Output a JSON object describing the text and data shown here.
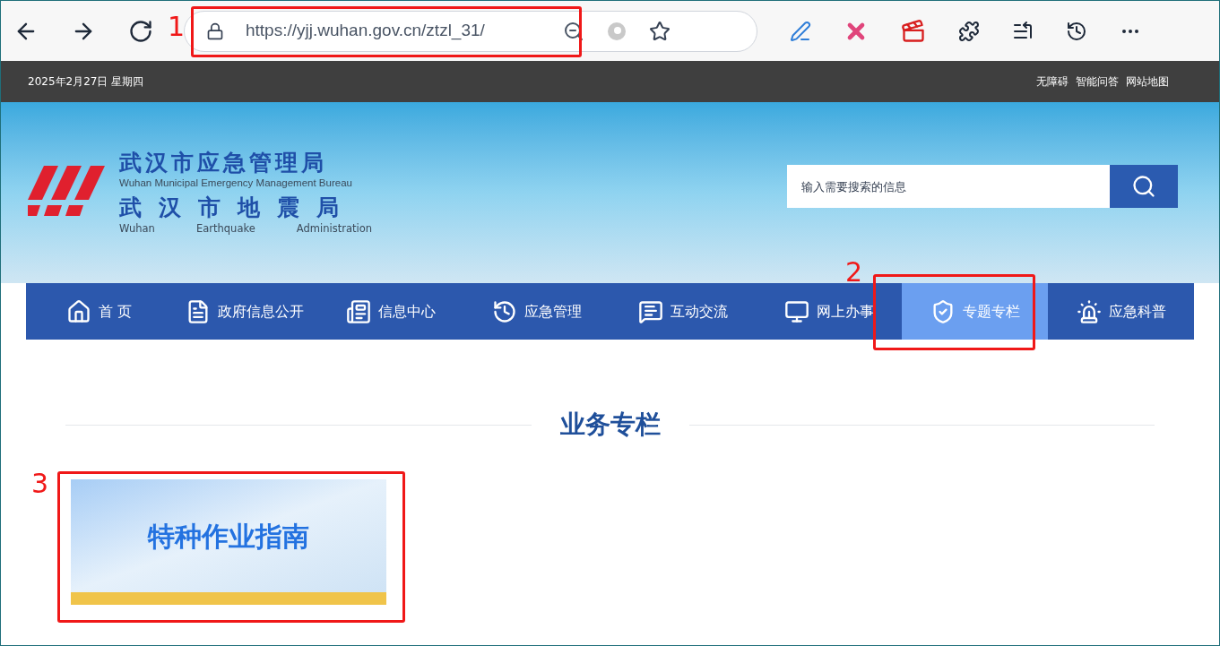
{
  "browser": {
    "url": "https://yjj.wuhan.gov.cn/ztzl_31/"
  },
  "top_bar": {
    "date": "2025年2月27日 星期四",
    "links": [
      "无障碍",
      "智能问答",
      "网站地图"
    ]
  },
  "header": {
    "title_cn": "武汉市应急管理局",
    "title_en": "Wuhan Municipal Emergency Management Bureau",
    "subtitle_cn": "武汉市地震局",
    "subtitle_en": [
      "Wuhan",
      "Earthquake",
      "Administration"
    ],
    "search": {
      "placeholder": "输入需要搜索的信息"
    }
  },
  "nav": [
    {
      "label": "首 页",
      "selected": false
    },
    {
      "label": "政府信息公开",
      "selected": false
    },
    {
      "label": "信息中心",
      "selected": false
    },
    {
      "label": "应急管理",
      "selected": false
    },
    {
      "label": "互动交流",
      "selected": false
    },
    {
      "label": "网上办事",
      "selected": false
    },
    {
      "label": "专题专栏",
      "selected": true
    },
    {
      "label": "应急科普",
      "selected": false
    }
  ],
  "section": {
    "title": "业务专栏",
    "cards": [
      {
        "title": "特种作业指南"
      }
    ]
  },
  "annotations": [
    {
      "label": "1"
    },
    {
      "label": "2"
    },
    {
      "label": "3"
    }
  ]
}
